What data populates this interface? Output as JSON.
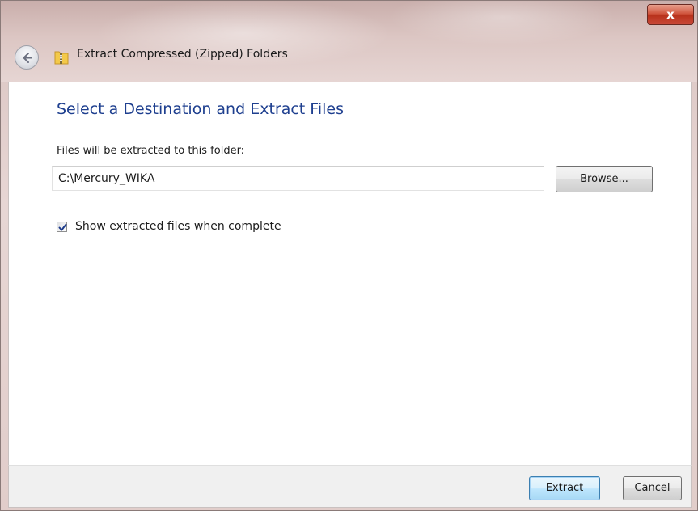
{
  "window": {
    "title": "Extract Compressed (Zipped) Folders",
    "close_label": "x"
  },
  "content": {
    "heading": "Select a Destination and Extract Files",
    "folder_label": "Files will be extracted to this folder:",
    "path_value": "C:\\Mercury_WIKA",
    "browse_label": "Browse...",
    "show_files_label": "Show extracted files when complete",
    "show_files_checked": true
  },
  "footer": {
    "extract_label": "Extract",
    "cancel_label": "Cancel"
  },
  "icons": {
    "back": "back-arrow-icon",
    "folder": "zip-folder-icon",
    "checkmark": "checkmark-icon"
  },
  "colors": {
    "heading": "#1e3f8f",
    "close_button": "#c8493a",
    "default_button": "#bee6fd"
  }
}
